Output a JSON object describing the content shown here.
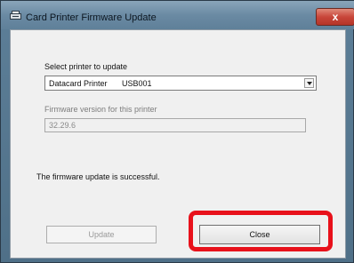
{
  "window": {
    "title": "Card Printer Firmware Update",
    "icon": "printer-icon",
    "close_glyph": "x"
  },
  "printer_select": {
    "label": "Select printer to update",
    "printer_name": "Datacard Printer",
    "port": "USB001",
    "arrow_icon": "dropdown-arrow-icon"
  },
  "firmware": {
    "label": "Firmware version for this printer",
    "value": "32.29.6"
  },
  "status": {
    "message": "The firmware update is successful."
  },
  "buttons": {
    "update_label": "Update",
    "close_label": "Close"
  },
  "colors": {
    "highlight": "#e8111b"
  }
}
